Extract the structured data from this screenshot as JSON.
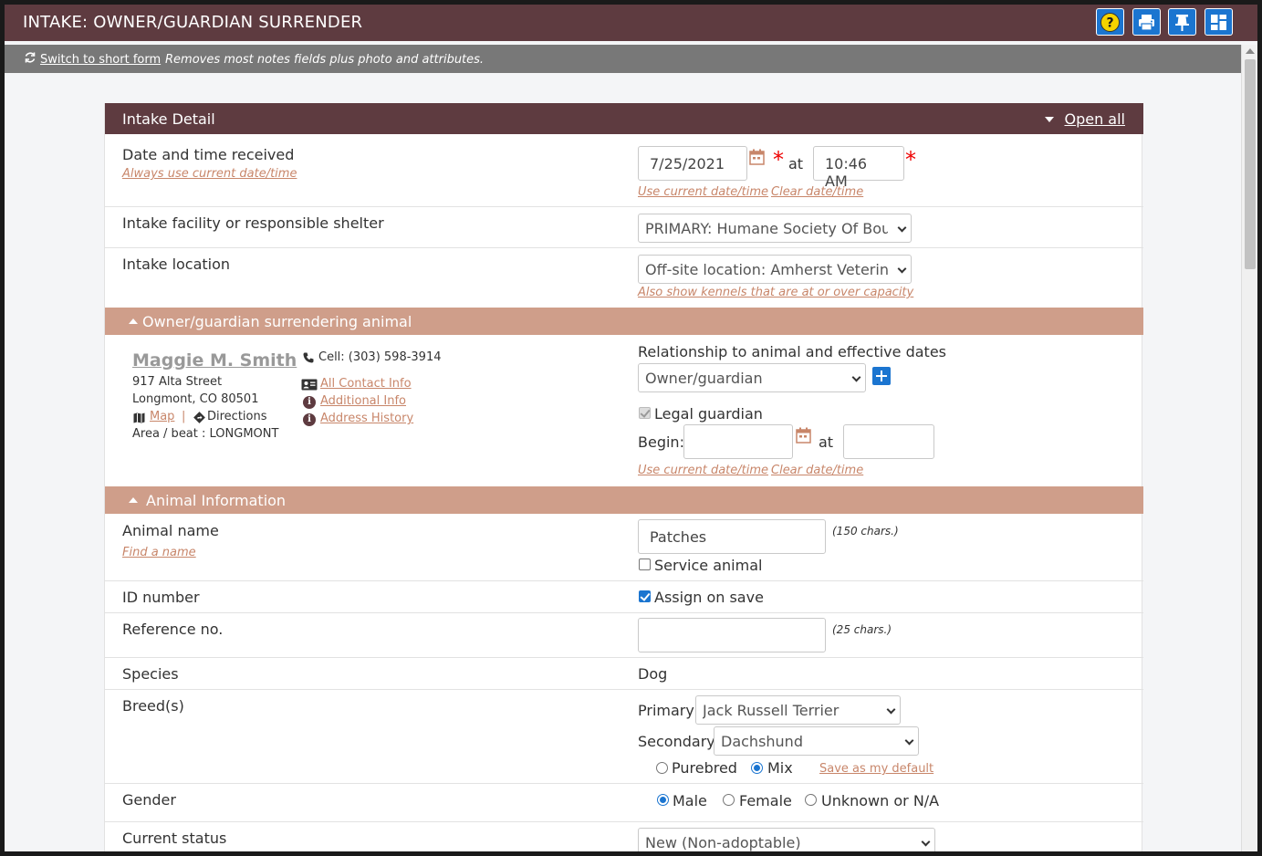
{
  "window": {
    "title": "INTAKE: OWNER/GUARDIAN SURRENDER"
  },
  "toolbar": {
    "icons": [
      "help-icon",
      "print-icon",
      "pin-icon",
      "layout-icon"
    ]
  },
  "subbar": {
    "switch_link": "Switch to short form",
    "note": "Removes most notes fields plus photo and attributes."
  },
  "intake_detail": {
    "header": "Intake Detail",
    "open_all": "Open all",
    "date_received": {
      "label": "Date and time received",
      "always_current": "Always use current date/time",
      "date": "7/25/2021",
      "at": "at",
      "time": "10:46 AM",
      "required_mark": "*",
      "use_current": "Use current date/time",
      "clear": "Clear date/time"
    },
    "facility": {
      "label": "Intake facility or responsible shelter",
      "value": "PRIMARY: Humane Society Of Boulder Valley"
    },
    "location": {
      "label": "Intake location",
      "value": "Off-site location: Amherst Veterinary Hospital",
      "also_show": "Also show kennels that are at or over capacity"
    }
  },
  "owner": {
    "header": "Owner/guardian surrendering animal",
    "name": "Maggie M. Smith",
    "street": "917 Alta Street",
    "city": "Longmont, CO 80501",
    "map": "Map",
    "separator": "|",
    "directions": "Directions",
    "area": "Area / beat : LONGMONT",
    "cell": "Cell: (303) 598-3914",
    "all_contact": "All Contact Info",
    "additional": "Additional Info",
    "address_history": "Address History",
    "info_glyph": "i",
    "relationship_label": "Relationship to animal and effective dates",
    "relationship_value": "Owner/guardian",
    "legal_guardian": "Legal guardian",
    "begin": "Begin:",
    "at": "at",
    "begin_date": "",
    "begin_time": "",
    "use_current": "Use current date/time",
    "clear": "Clear date/time"
  },
  "animal": {
    "header": "Animal Information",
    "name_label": "Animal name",
    "find_name": "Find a name",
    "name_value": "Patches",
    "name_hint": "(150 chars.)",
    "service_animal": "Service animal",
    "id_label": "ID number",
    "assign_on_save": "Assign on save",
    "ref_label": "Reference no.",
    "ref_value": "",
    "ref_hint": "(25 chars.)",
    "species_label": "Species",
    "species_value": "Dog",
    "breed_label": "Breed(s)",
    "primary_label": "Primary",
    "primary_value": "Jack Russell Terrier",
    "secondary_label": "Secondary",
    "secondary_value": "Dachshund",
    "purebred": "Purebred",
    "mix": "Mix",
    "save_default": "Save as my default",
    "gender_label": "Gender",
    "male": "Male",
    "female": "Female",
    "unknown": "Unknown or N/A",
    "status_label": "Current status",
    "status_value": "New (Non-adoptable)"
  },
  "colors": {
    "title_bar": "#5e3b40",
    "section_tan": "#cf9e8a",
    "accent_blue": "#1b75d0",
    "link": "#c8866a",
    "required": "#e00000"
  }
}
